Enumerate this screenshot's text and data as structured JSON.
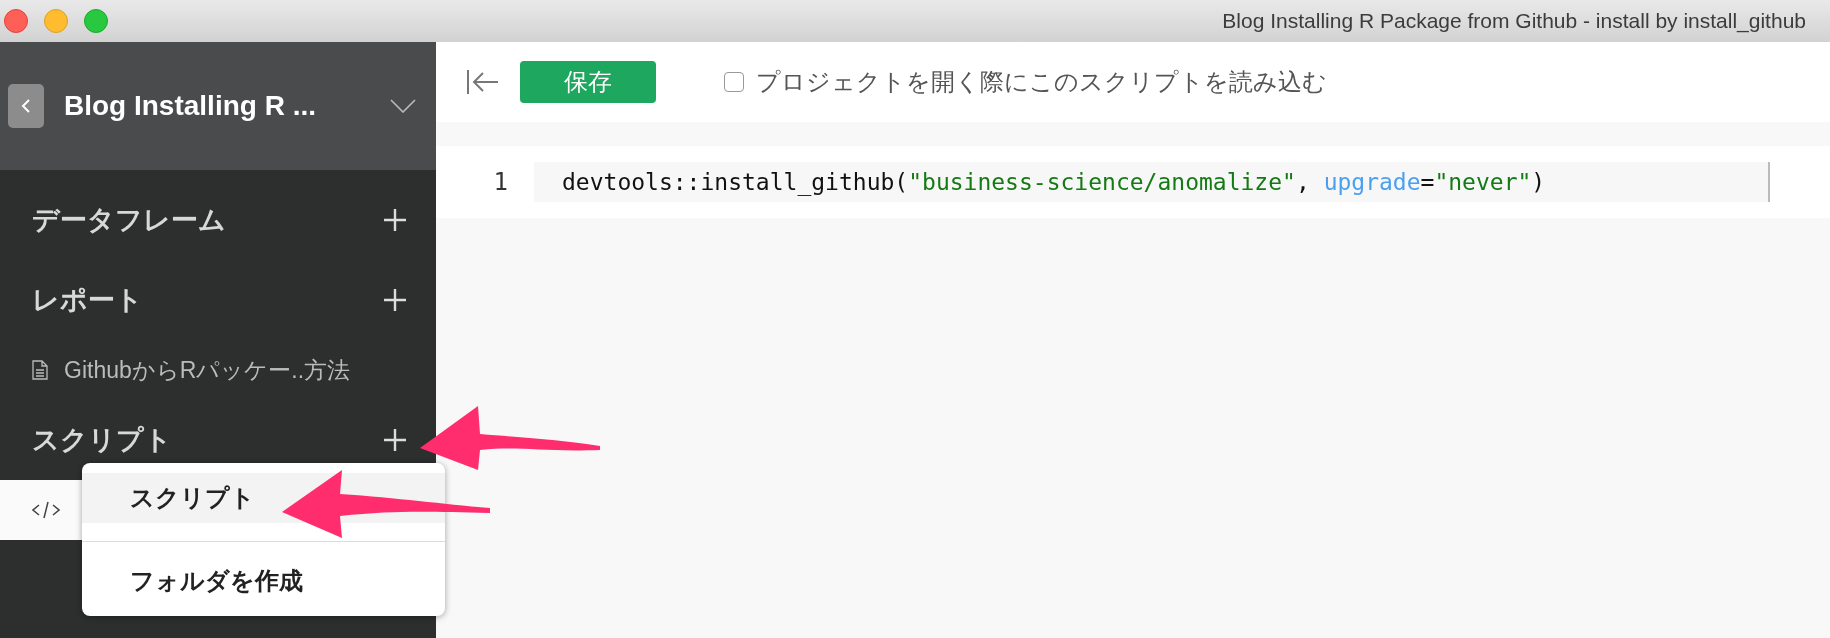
{
  "window": {
    "title": "Blog Installing R Package from Github - install by install_github"
  },
  "sidebar": {
    "project_title": "Blog Installing R ...",
    "sections": [
      {
        "title": "データフレーム"
      },
      {
        "title": "レポート",
        "items": [
          {
            "kind": "report",
            "label": "GithubからRパッケー..方法",
            "selected": false
          }
        ]
      },
      {
        "title": "スクリプト",
        "items": [
          {
            "kind": "script",
            "selected": true
          }
        ]
      }
    ]
  },
  "add_menu": {
    "items": [
      {
        "label": "スクリプト",
        "selected": true
      },
      {
        "label": "フォルダを作成",
        "selected": false
      }
    ]
  },
  "toolbar": {
    "save_label": "保存",
    "load_on_open": {
      "label": "プロジェクトを開く際にこのスクリプトを読み込む",
      "checked": false
    }
  },
  "editor": {
    "lines": [
      {
        "number": "1",
        "tokens": [
          {
            "kind": "plain",
            "text": "devtools::install_github("
          },
          {
            "kind": "string",
            "text": "\"business-science/anomalize\""
          },
          {
            "kind": "plain",
            "text": ", "
          },
          {
            "kind": "param",
            "text": "upgrade"
          },
          {
            "kind": "plain",
            "text": "="
          },
          {
            "kind": "string",
            "text": "\"never\""
          },
          {
            "kind": "plain",
            "text": ")"
          }
        ]
      }
    ]
  }
}
